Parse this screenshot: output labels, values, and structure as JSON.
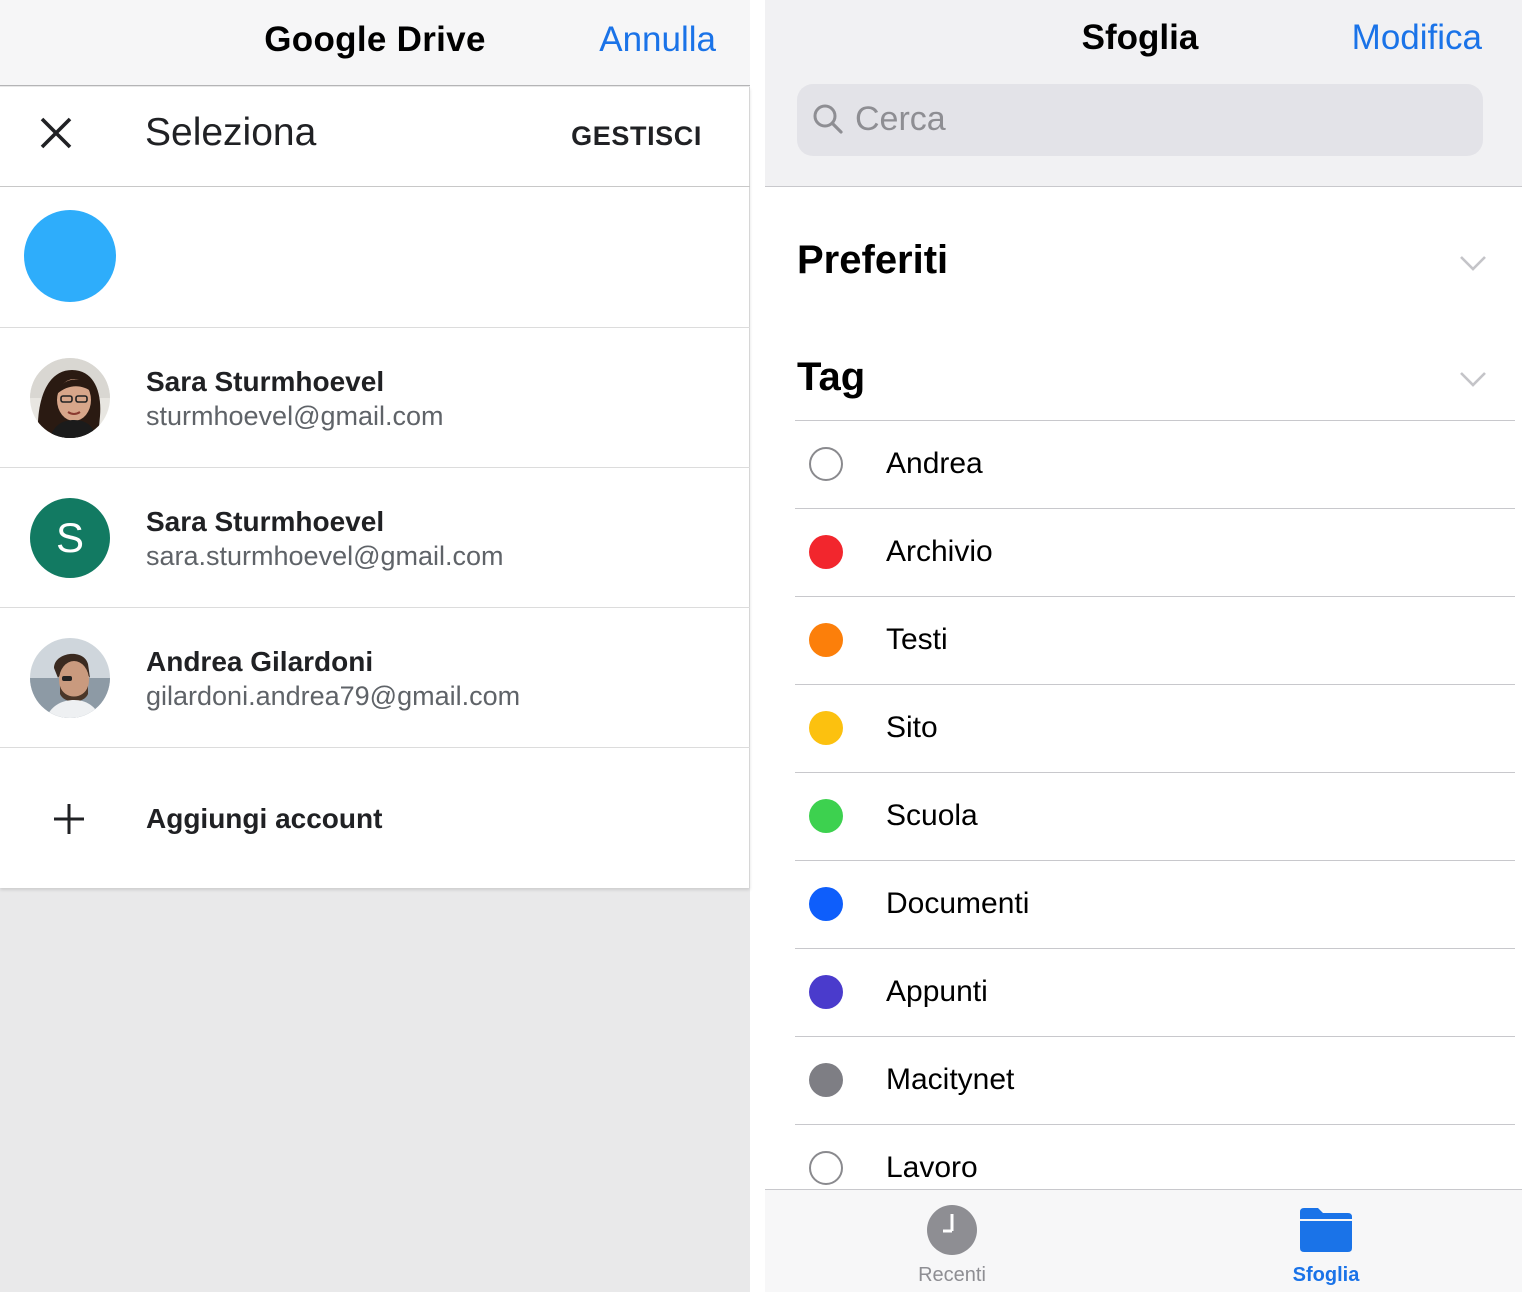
{
  "left": {
    "app_title": "Google Drive",
    "cancel_label": "Annulla",
    "dialog": {
      "title": "Seleziona",
      "manage_label": "GESTISCI"
    },
    "accounts": [
      {
        "name": "",
        "email": "",
        "avatar_color": "#2eadfb"
      },
      {
        "name": "Sara Sturmhoevel",
        "email": "sturmhoevel@gmail.com",
        "avatar": "photo"
      },
      {
        "name": "Sara Sturmhoevel",
        "email": "sara.sturmhoevel@gmail.com",
        "avatar_letter": "S",
        "avatar_color": "#127a62"
      },
      {
        "name": "Andrea Gilardoni",
        "email": "gilardoni.andrea79@gmail.com",
        "avatar": "photo"
      }
    ],
    "add_account_label": "Aggiungi account"
  },
  "right": {
    "title": "Sfoglia",
    "edit_label": "Modifica",
    "search": {
      "placeholder": "Cerca"
    },
    "sections": {
      "favorites": "Preferiti",
      "tags": "Tag"
    },
    "tags": [
      {
        "label": "Andrea",
        "color": ""
      },
      {
        "label": "Archivio",
        "color": "#f2262d"
      },
      {
        "label": "Testi",
        "color": "#fc7f0a"
      },
      {
        "label": "Sito",
        "color": "#fcc10f"
      },
      {
        "label": "Scuola",
        "color": "#3dd14f"
      },
      {
        "label": "Documenti",
        "color": "#0e5efb"
      },
      {
        "label": "Appunti",
        "color": "#4a3bcc"
      },
      {
        "label": "Macitynet",
        "color": "#7e7e84"
      },
      {
        "label": "Lavoro",
        "color": ""
      }
    ],
    "tabbar": {
      "recent_label": "Recenti",
      "browse_label": "Sfoglia",
      "active": "browse"
    }
  },
  "colors": {
    "accent": "#1a73e8",
    "recent_icon": "#8e8e93"
  }
}
